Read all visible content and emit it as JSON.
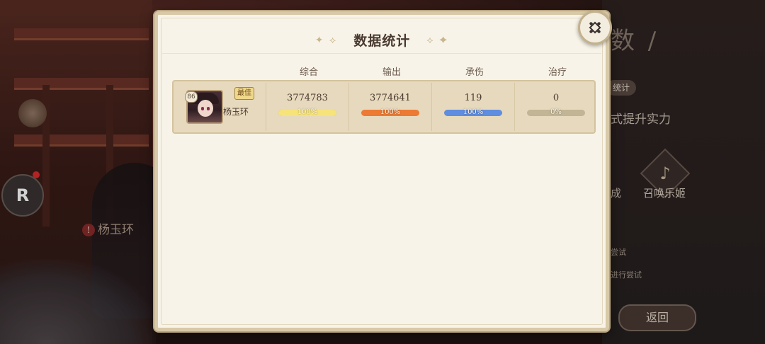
{
  "background": {
    "right_title": "数 /",
    "right_chip": "统计",
    "right_text": "式提升实力",
    "right_action_1": "成",
    "right_action_2": "召唤乐姬",
    "right_hint_1": "尝试",
    "right_hint_2": "进行尝试",
    "return_button": "返回",
    "character_label": "杨玉环",
    "r_badge": "R"
  },
  "panel": {
    "title": "数据统计",
    "title_ornament_left": "✦ ⟡",
    "title_ornament_right": "⟡ ✦",
    "columns": [
      "综合",
      "输出",
      "承伤",
      "治疗"
    ]
  },
  "rows": [
    {
      "level": "86",
      "badge": "最佳",
      "name": "杨玉环",
      "stats": [
        {
          "value": "3774783",
          "percent": 100,
          "percent_label": "100%",
          "color": "#f6e37a"
        },
        {
          "value": "3774641",
          "percent": 100,
          "percent_label": "100%",
          "color": "#ec7a33"
        },
        {
          "value": "119",
          "percent": 100,
          "percent_label": "100%",
          "color": "#5f8de0"
        },
        {
          "value": "0",
          "percent": 0,
          "percent_label": "0%",
          "color": "#c2b596"
        }
      ]
    }
  ],
  "close_icon": "close-x-icon"
}
